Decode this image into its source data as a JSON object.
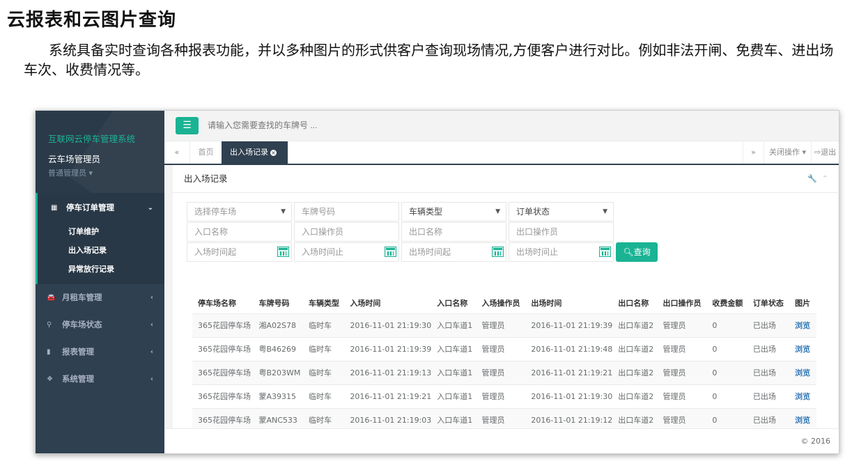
{
  "doc": {
    "title": "云报表和云图片查询",
    "paragraph": "系统具备实时查询各种报表功能，并以多种图片的形式供客户查询现场情况,方便客户进行对比。例如非法开闸、免费车、进出场车次、收费情况等。"
  },
  "sidebar": {
    "system_name": "互联网云停车管理系统",
    "user_name": "云车场管理员",
    "user_role": "普通管理员",
    "active_group": {
      "label": "停车订单管理",
      "icon": "grid-icon",
      "items": [
        "订单维护",
        "出入场记录",
        "异常放行记录"
      ]
    },
    "groups": [
      {
        "label": "月租车管理",
        "icon": "car-icon"
      },
      {
        "label": "停车场状态",
        "icon": "binoculars-icon"
      },
      {
        "label": "报表管理",
        "icon": "bar-chart-icon"
      },
      {
        "label": "系统管理",
        "icon": "cubes-icon"
      }
    ]
  },
  "topbar": {
    "menu_icon": "hamburger-icon",
    "search_placeholder": "请输入您需要查找的车牌号 ..."
  },
  "tabs": {
    "home": "首页",
    "current": "出入场记录",
    "close_ops": "关闭操作",
    "logout": "退出"
  },
  "panel": {
    "title": "出入场记录",
    "filters": {
      "parking_lot": "选择停车场",
      "plate": "车牌号码",
      "vehicle_type": "车辆类型",
      "order_status": "订单状态",
      "entry_name": "入口名称",
      "entry_operator": "入口操作员",
      "exit_name": "出口名称",
      "exit_operator": "出口操作员",
      "entry_from": "入场时间起",
      "entry_to": "入场时间止",
      "exit_from": "出场时间起",
      "exit_to": "出场时间止",
      "query": "查询"
    },
    "columns": [
      "停车场名称",
      "车牌号码",
      "车辆类型",
      "入场时间",
      "入口名称",
      "入场操作员",
      "出场时间",
      "出口名称",
      "出口操作员",
      "收费金额",
      "订单状态",
      "图片"
    ],
    "rows": [
      [
        "365花园停车场",
        "湘A02S78",
        "临时车",
        "2016-11-01 21:19:30",
        "入口车道1",
        "管理员",
        "2016-11-01 21:19:39",
        "出口车道2",
        "管理员",
        "0",
        "已出场",
        "浏览"
      ],
      [
        "365花园停车场",
        "粤B46269",
        "临时车",
        "2016-11-01 21:19:39",
        "入口车道1",
        "管理员",
        "2016-11-01 21:19:48",
        "出口车道2",
        "管理员",
        "0",
        "已出场",
        "浏览"
      ],
      [
        "365花园停车场",
        "粤B203WM",
        "临时车",
        "2016-11-01 21:19:13",
        "入口车道1",
        "管理员",
        "2016-11-01 21:19:21",
        "出口车道2",
        "管理员",
        "0",
        "已出场",
        "浏览"
      ],
      [
        "365花园停车场",
        "蒙A39315",
        "临时车",
        "2016-11-01 21:19:21",
        "入口车道1",
        "管理员",
        "2016-11-01 21:19:30",
        "出口车道2",
        "管理员",
        "0",
        "已出场",
        "浏览"
      ],
      [
        "365花园停车场",
        "蒙ANC533",
        "临时车",
        "2016-11-01 21:19:03",
        "入口车道1",
        "管理员",
        "2016-11-01 21:19:12",
        "出口车道2",
        "管理员",
        "0",
        "已出场",
        "浏览"
      ]
    ]
  },
  "footer": {
    "copyright": "© 2016"
  },
  "colors": {
    "accent": "#1ab394",
    "sidebar": "#2f4050",
    "link": "#337ab7"
  }
}
